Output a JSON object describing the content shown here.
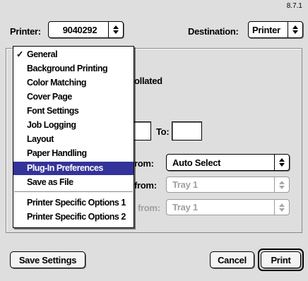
{
  "version": "8.7.1",
  "printer": {
    "label": "Printer:",
    "value": "9040292"
  },
  "destination": {
    "label": "Destination:",
    "value": "Printer"
  },
  "general": {
    "collated_fragment": "ollated",
    "to_label": "To:",
    "paper_source": [
      {
        "label": "rom:",
        "value": "Auto Select",
        "enabled": true
      },
      {
        "label": "from:",
        "value": "Tray 1",
        "enabled": false
      },
      {
        "label": "from:",
        "value": "Tray 1",
        "enabled": false
      }
    ]
  },
  "panel_menu": {
    "selected": "Plug-In Preferences",
    "checked": "General",
    "items": [
      "General",
      "Background Printing",
      "Color Matching",
      "Cover Page",
      "Font Settings",
      "Job Logging",
      "Layout",
      "Paper Handling",
      "Plug-In Preferences",
      "Save as File",
      "Printer Specific Options 1",
      "Printer Specific Options 2"
    ]
  },
  "buttons": {
    "save_settings": "Save Settings",
    "cancel": "Cancel",
    "print": "Print"
  },
  "colors": {
    "window_bg": "#dedede",
    "menu_highlight": "#333399"
  }
}
